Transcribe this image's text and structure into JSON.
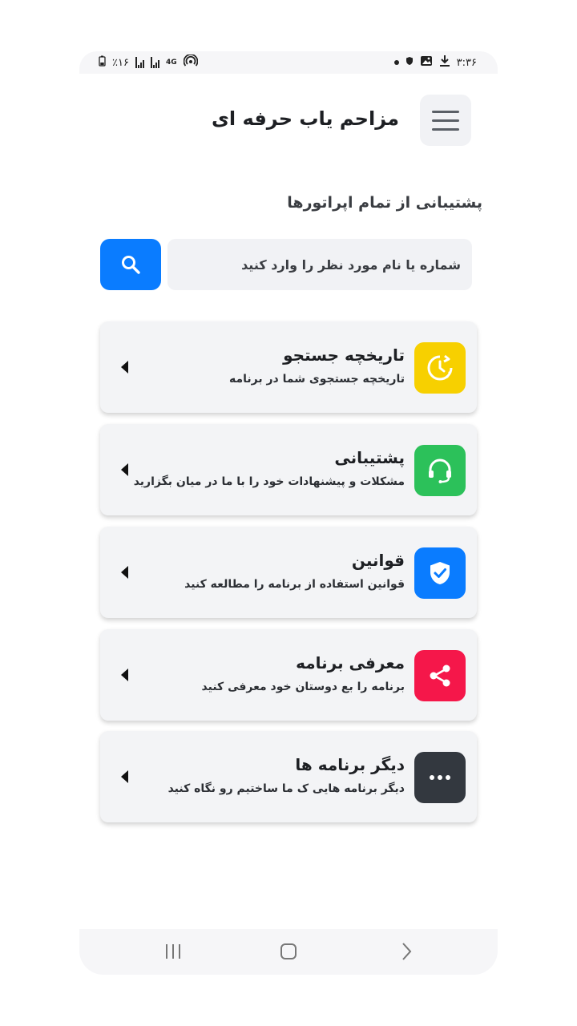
{
  "status_bar": {
    "time": "۳:۳۶",
    "battery": "٪۱۶",
    "network": "4G"
  },
  "header": {
    "title": "مزاحم یاب حرفه ای",
    "menu_icon": "hamburger-menu-icon"
  },
  "subtitle": "پشتیبانی از تمام اپراتورها",
  "search": {
    "placeholder": "شماره یا نام مورد نظر را وارد کنید",
    "value": "",
    "button_icon": "search-icon"
  },
  "menu_items": [
    {
      "title": "تاریخچه جستجو",
      "description": "تاریخچه جستجوی شما در برنامه",
      "icon": "history-clock-icon",
      "color": "#f7d000"
    },
    {
      "title": "پشتیبانی",
      "description": "مشکلات و پیشنهادات خود را با ما در میان بگزارید",
      "icon": "headset-icon",
      "color": "#2cc15a"
    },
    {
      "title": "قوانین",
      "description": "قوانین استفاده از برنامه را مطالعه کنید",
      "icon": "shield-check-icon",
      "color": "#0a7cff"
    },
    {
      "title": "معرفی برنامه",
      "description": "برنامه را بع دوستان خود معرفی کنید",
      "icon": "share-icon",
      "color": "#f5174a"
    },
    {
      "title": "دیگر برنامه ها",
      "description": "دیگر برنامه هایی ک ما ساختیم رو نگاه کنید",
      "icon": "more-dots-icon",
      "color": "#33383f"
    }
  ],
  "nav": {
    "recents_icon": "recents-icon",
    "home_icon": "home-icon",
    "back_icon": "back-icon"
  }
}
